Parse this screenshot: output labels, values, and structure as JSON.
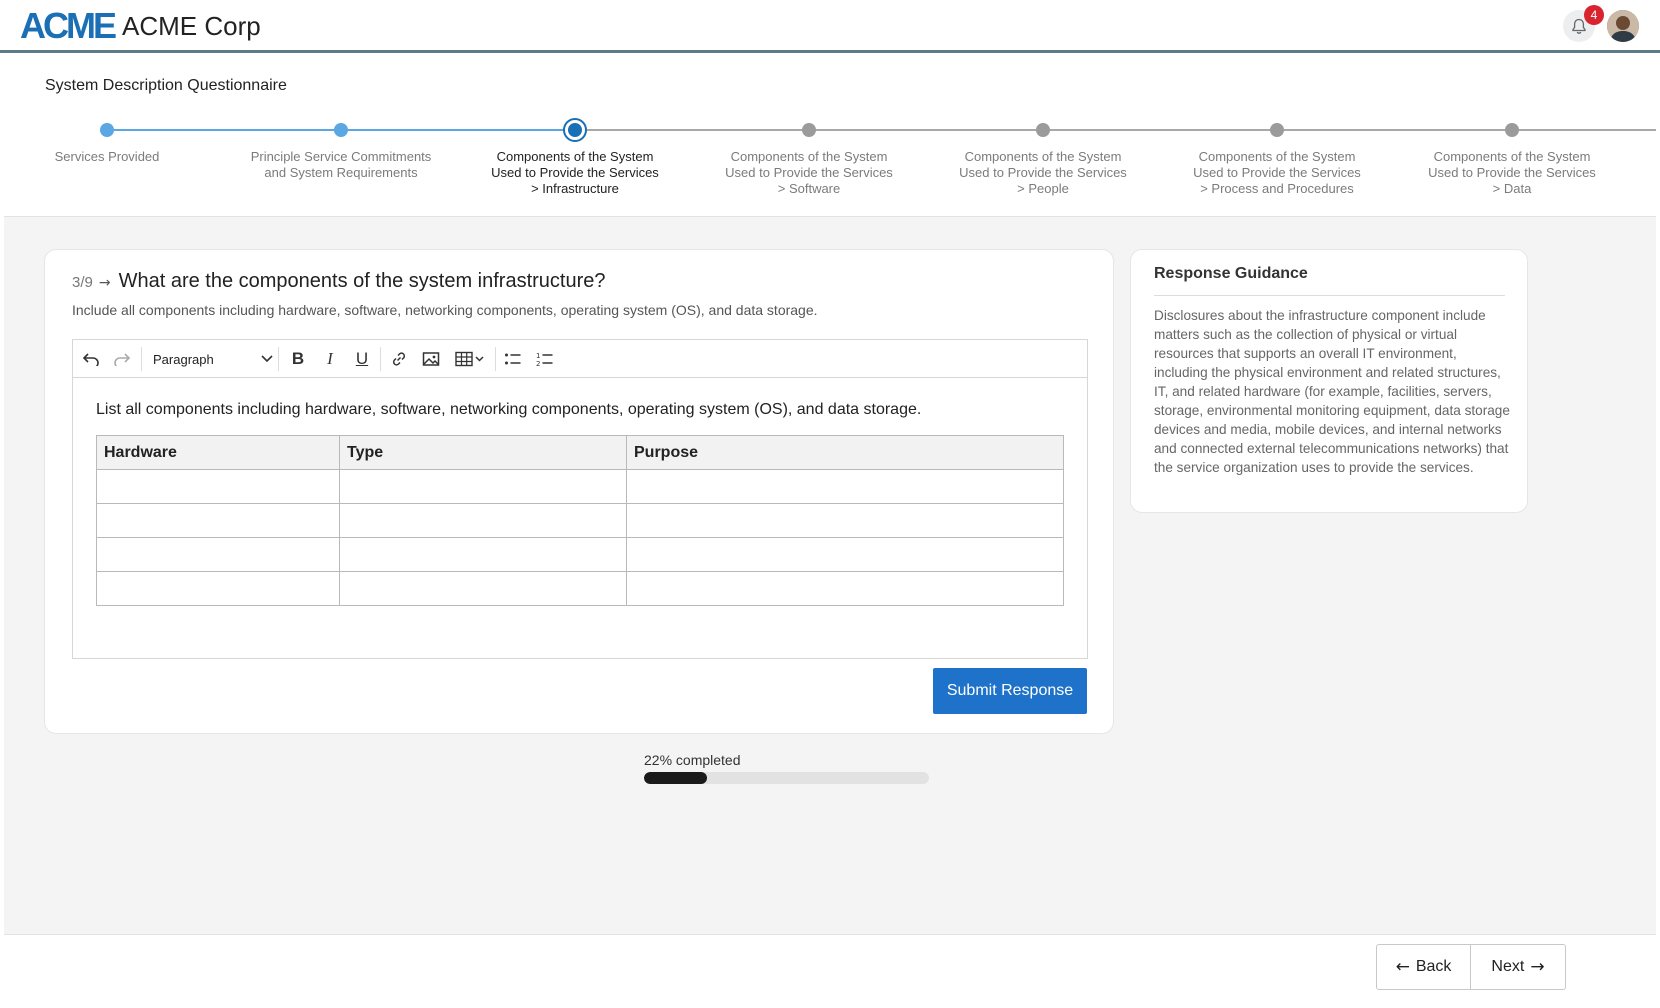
{
  "header": {
    "logo_text": "ACME",
    "company_name": "ACME Corp",
    "notification_count": "4"
  },
  "questionnaire": {
    "title": "System Description Questionnaire"
  },
  "steps": [
    {
      "label": "Services Provided",
      "state": "done"
    },
    {
      "label": "Principle Service Commitments\nand System Requirements",
      "state": "done"
    },
    {
      "label": "Components of the System\nUsed to Provide the Services\n> Infrastructure",
      "state": "current"
    },
    {
      "label": "Components of the System\nUsed to Provide the Services\n> Software",
      "state": "todo"
    },
    {
      "label": "Components of the System\nUsed to Provide the Services\n> People",
      "state": "todo"
    },
    {
      "label": "Components of the System\nUsed to Provide the Services\n> Process and Procedures",
      "state": "todo"
    },
    {
      "label": "Components of the System\nUsed to Provide the Services\n> Data",
      "state": "todo"
    }
  ],
  "question": {
    "number": "3/9",
    "text": "What are the components of the system infrastructure?",
    "subtitle": "Include all components including hardware, software, networking components, operating system (OS), and data storage."
  },
  "editor": {
    "paragraph_style": "Paragraph",
    "body_text": "List all components including hardware, software, networking components, operating system (OS), and data storage.",
    "table_headers": [
      "Hardware",
      "Type",
      "Purpose"
    ],
    "empty_rows": 4
  },
  "submit_label": "Submit Response",
  "guidance": {
    "title": "Response Guidance",
    "text": "Disclosures about the infrastructure component include matters such as the collection of physical or virtual resources that supports an overall IT environment, including the physical environment and related structures, IT, and related hardware (for example, facilities, servers, storage, environmental monitoring equipment, data storage devices and media, mobile devices, and internal networks and connected external telecommunications networks) that the service organization uses to provide the services."
  },
  "progress": {
    "label": "22% completed",
    "percent": 22
  },
  "footer": {
    "back_label": "Back",
    "next_label": "Next"
  }
}
